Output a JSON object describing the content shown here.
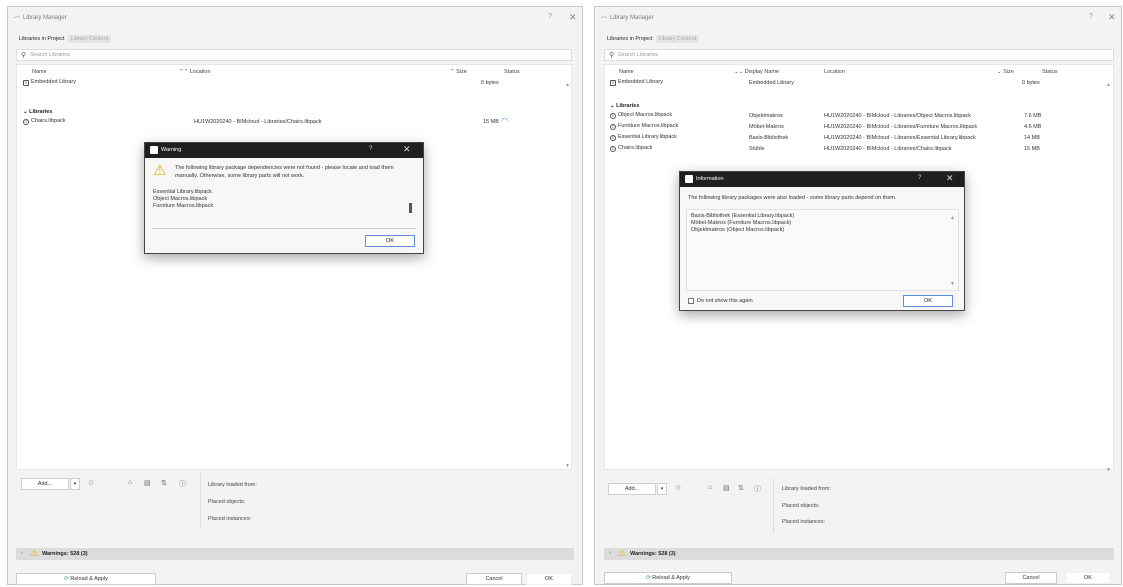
{
  "left": {
    "window_title": "Library Manager",
    "help": "?",
    "close": "✕",
    "tabs": [
      "Libraries in Project",
      "Library Content"
    ],
    "search_placeholder": "Search Libraries",
    "columns": {
      "name": "Name",
      "location": "Location",
      "size": "Size",
      "status": "Status"
    },
    "embedded": {
      "name": "Embedded Library",
      "size": "0 bytes"
    },
    "group": "Libraries",
    "libraries": [
      {
        "name": "Chairs.libpack",
        "location": "HU1W2020240 - BIMcloud - Libraries/Chairs.libpack",
        "size": "15 MB"
      }
    ],
    "add_button": "Add...",
    "info_loaded": "Library loaded from:",
    "info_placed_objects": "Placed objects:",
    "info_placed_instances": "Placed instances:",
    "warnings": "Warnings: 528 (3)",
    "reload_button": "Reload & Apply",
    "cancel_button": "Cancel",
    "ok_button": "OK",
    "dialog": {
      "title": "Warning",
      "help": "?",
      "close": "✕",
      "message": "The following library package dependencies were not found - please locate and load them manually. Otherwise, some library parts will not work.",
      "items": [
        "Essential Library.libpack",
        "Object Macros.libpack",
        "Furniture Macros.libpack"
      ],
      "ok": "OK"
    }
  },
  "right": {
    "window_title": "Library Manager",
    "help": "?",
    "close": "✕",
    "tabs": [
      "Libraries in Project",
      "Library Content"
    ],
    "search_placeholder": "Search Libraries",
    "columns": {
      "name": "Name",
      "display": "Display Name",
      "location": "Location",
      "size": "Size",
      "status": "Status"
    },
    "embedded": {
      "name": "Embedded Library",
      "display": "Embedded Library",
      "size": "0 bytes"
    },
    "group": "Libraries",
    "libraries": [
      {
        "name": "Object Macros.libpack",
        "display": "Objektmakros",
        "location": "HU1W2020240 - BIMcloud - Libraries/Object Macros.libpack",
        "size": "7.6 MB"
      },
      {
        "name": "Furniture Macros.libpack",
        "display": "Möbel-Makros",
        "location": "HU1W2020240 - BIMcloud - Libraries/Furniture Macros.libpack",
        "size": "4.6 MB"
      },
      {
        "name": "Essential Library.libpack",
        "display": "Basis-Bibliothek",
        "location": "HU1W2020240 - BIMcloud - Libraries/Essential Library.libpack",
        "size": "14 MB"
      },
      {
        "name": "Chairs.libpack",
        "display": "Stühle",
        "location": "HU1W2020240 - BIMcloud - Libraries/Chairs.libpack",
        "size": "15 MB"
      }
    ],
    "add_button": "Add...",
    "info_loaded": "Library loaded from:",
    "info_placed_objects": "Placed objects:",
    "info_placed_instances": "Placed instances:",
    "warnings": "Warnings: 528 (3)",
    "reload_button": "Reload & Apply",
    "cancel_button": "Cancel",
    "ok_button": "OK",
    "dialog": {
      "title": "Information",
      "help": "?",
      "close": "✕",
      "message": "The following library packages were also loaded - some library parts depend on them.",
      "items": [
        "Basis-Bibliothek (Essential Library.libpack)",
        "Möbel-Makros (Furniture Macros.libpack)",
        "Objektmakros (Object Macros.libpack)"
      ],
      "checkbox_label": "Do not show this again",
      "ok": "OK"
    }
  },
  "colors": {
    "dialog_header": "#1f1f1f",
    "warning_yellow": "#e6b400",
    "ok_border": "#5b8fd9"
  }
}
